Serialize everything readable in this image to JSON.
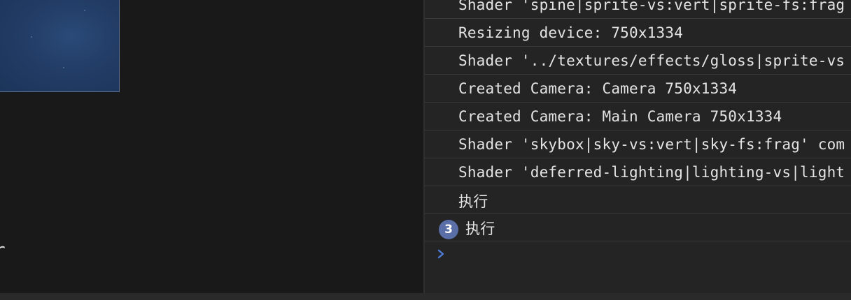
{
  "left_pane": {
    "preview_image": "blue-starfield-image",
    "cut_text": "r"
  },
  "console": {
    "messages": [
      {
        "text": "Shader 'spine|sprite-vs:vert|sprite-fs:frag"
      },
      {
        "text": "Resizing device: 750x1334"
      },
      {
        "text": "Shader '../textures/effects/gloss|sprite-vs"
      },
      {
        "text": "Created Camera: Camera 750x1334"
      },
      {
        "text": "Created Camera: Main Camera 750x1334"
      },
      {
        "text": "Shader 'skybox|sky-vs:vert|sky-fs:frag' com"
      },
      {
        "text": "Shader 'deferred-lighting|lighting-vs|light"
      },
      {
        "text": "执行"
      },
      {
        "text": "执行",
        "repeat_count": "3"
      }
    ],
    "prompt": {
      "icon": "chevron-right-icon",
      "value": "",
      "accent": "#4f7bd9"
    }
  }
}
